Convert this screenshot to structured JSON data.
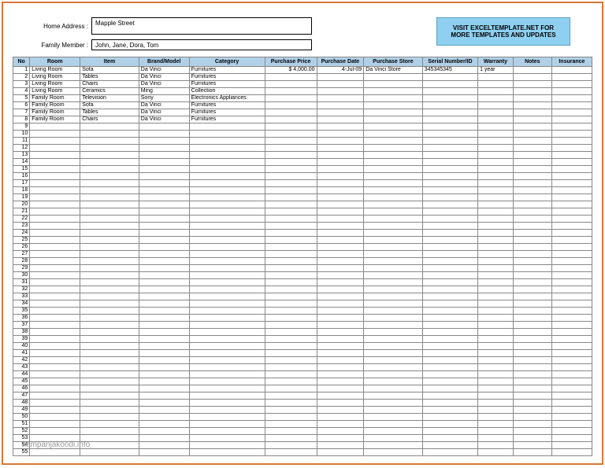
{
  "form": {
    "address_label": "Home Address :",
    "address_value": "Mapple Street",
    "member_label": "Family Member :",
    "member_value": "John, Jane, Dora, Tom"
  },
  "promo": {
    "text": "VISIT EXCELTEMPLATE.NET FOR MORE TEMPLATES AND UPDATES"
  },
  "columns": [
    "No",
    "Room",
    "Item",
    "Brand/Model",
    "Category",
    "Purchase Price",
    "Purchase Date",
    "Purchase Store",
    "Serial Number/ID",
    "Warranty",
    "Notes",
    "Insurance"
  ],
  "rows": [
    {
      "no": "1",
      "room": "Living Room",
      "item": "Sofa",
      "brand": "Da Vinci",
      "category": "Furnitures",
      "price": "$        4,000.00",
      "date": "4-Jul-09",
      "store": "Da Vinci Store",
      "serial": "345345345",
      "warranty": "1 year",
      "notes": "",
      "insurance": ""
    },
    {
      "no": "2",
      "room": "Living Room",
      "item": "Tables",
      "brand": "Da Vinci",
      "category": "Furnitures",
      "price": "",
      "date": "",
      "store": "",
      "serial": "",
      "warranty": "",
      "notes": "",
      "insurance": ""
    },
    {
      "no": "3",
      "room": "Living Room",
      "item": "Chairs",
      "brand": "Da Vinci",
      "category": "Furnitures",
      "price": "",
      "date": "",
      "store": "",
      "serial": "",
      "warranty": "",
      "notes": "",
      "insurance": ""
    },
    {
      "no": "4",
      "room": "Living Room",
      "item": "Ceramics",
      "brand": "Ming",
      "category": "Collection",
      "price": "",
      "date": "",
      "store": "",
      "serial": "",
      "warranty": "",
      "notes": "",
      "insurance": ""
    },
    {
      "no": "5",
      "room": "Family Room",
      "item": "Television",
      "brand": "Sony",
      "category": "Electronics Appliances",
      "price": "",
      "date": "",
      "store": "",
      "serial": "",
      "warranty": "",
      "notes": "",
      "insurance": ""
    },
    {
      "no": "6",
      "room": "Family Room",
      "item": "Sofa",
      "brand": "Da Vinci",
      "category": "Furnitures",
      "price": "",
      "date": "",
      "store": "",
      "serial": "",
      "warranty": "",
      "notes": "",
      "insurance": ""
    },
    {
      "no": "7",
      "room": "Family Room",
      "item": "Tables",
      "brand": "Da Vinci",
      "category": "Furnitures",
      "price": "",
      "date": "",
      "store": "",
      "serial": "",
      "warranty": "",
      "notes": "",
      "insurance": ""
    },
    {
      "no": "8",
      "room": "Family Room",
      "item": "Chairs",
      "brand": "Da Vinci",
      "category": "Furnitures",
      "price": "",
      "date": "",
      "store": "",
      "serial": "",
      "warranty": "",
      "notes": "",
      "insurance": ""
    }
  ],
  "total_rows": 55,
  "watermark": "kampanjakoodi.info"
}
